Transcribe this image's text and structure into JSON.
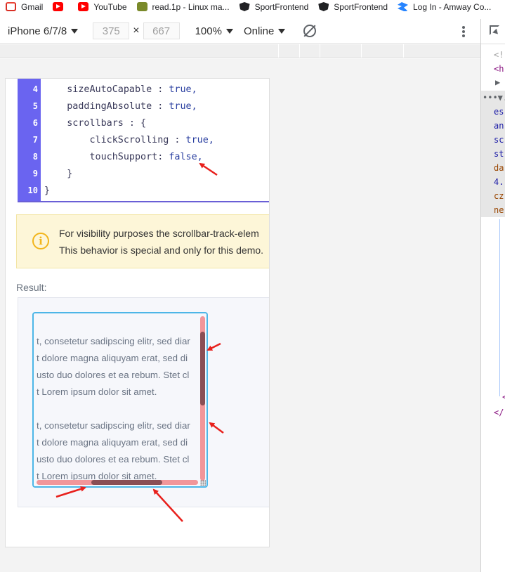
{
  "bookmarks": [
    {
      "label": "Gmail",
      "icon": "gmail-icon"
    },
    {
      "label": "",
      "icon": "youtube-icon"
    },
    {
      "label": "YouTube",
      "icon": "youtube-icon"
    },
    {
      "label": "read.1p - Linux ma...",
      "icon": "read-icon"
    },
    {
      "label": "SportFrontend",
      "icon": "angular-icon"
    },
    {
      "label": "SportFrontend",
      "icon": "angular-icon"
    },
    {
      "label": "Log In - Amway Co...",
      "icon": "confluence-icon"
    }
  ],
  "device_toolbar": {
    "device": "iPhone 6/7/8",
    "width": "375",
    "height": "667",
    "times": "×",
    "zoom": "100%",
    "network": "Online"
  },
  "code": {
    "lines": [
      {
        "num": "4",
        "text": "    sizeAutoCapable : ",
        "value": "true,"
      },
      {
        "num": "5",
        "text": "    paddingAbsolute : ",
        "value": "true,"
      },
      {
        "num": "6",
        "text": "    scrollbars : {",
        "value": ""
      },
      {
        "num": "7",
        "text": "        clickScrolling : ",
        "value": "true,"
      },
      {
        "num": "8",
        "text": "        touchSupport: ",
        "value": "false,"
      },
      {
        "num": "9",
        "text": "    }",
        "value": ""
      },
      {
        "num": "10",
        "text": "}",
        "value": ""
      }
    ]
  },
  "notice": {
    "line1": "For visibility purposes the scrollbar-track-elem",
    "line2": "This behavior is special and only for this demo."
  },
  "result": {
    "label": "Result:",
    "paragraphs": [
      [
        "t, consetetur sadipscing elitr, sed diar",
        "t dolore magna aliquyam erat, sed di",
        "usto duo dolores et ea rebum. Stet cl",
        "t Lorem ipsum dolor sit amet."
      ],
      [
        "t, consetetur sadipscing elitr, sed diar",
        "t dolore magna aliquyam erat, sed di",
        "usto duo dolores et ea rebum. Stet cl",
        "t Lorem ipsum dolor sit amet."
      ]
    ]
  },
  "scrollbars": {
    "vertical_position": 0.17,
    "vertical_thumb_fraction": 0.45,
    "horizontal_position": 0.34,
    "horizontal_thumb_fraction": 0.44
  },
  "devtools": {
    "lines": [
      "<!",
      "<h",
      "▶ .",
      "•••▼.",
      "es",
      "an",
      "sc",
      "st",
      "da",
      "4.",
      "cz",
      "ne",
      "<",
      "</"
    ]
  },
  "colors": {
    "gutter": "#6a64f0",
    "scroll_track": "#f1969a",
    "scroll_thumb": "#8a4e55",
    "annotation_arrow": "#e8201c"
  }
}
